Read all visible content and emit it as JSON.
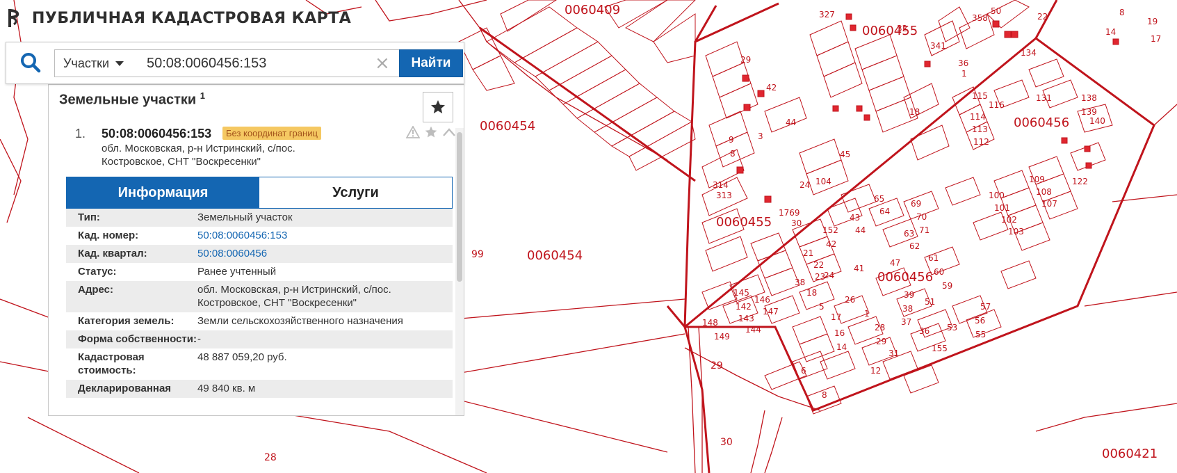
{
  "app": {
    "title": "ПУБЛИЧНАЯ КАДАСТРОВАЯ КАРТА"
  },
  "search": {
    "type_label": "Участки",
    "query": "50:08:0060456:153",
    "find_label": "Найти"
  },
  "results": {
    "header": "Земельные участки",
    "count": "1",
    "item": {
      "number": "1.",
      "title": "50:08:0060456:153",
      "badge": "Без координат границ",
      "address": "обл. Московская, р-н Истринский, с/пос. Костровское, СНТ \"Воскресенки\""
    },
    "tabs": {
      "info": "Информация",
      "services": "Услуги"
    },
    "rows": [
      {
        "key": "Тип:",
        "value": "Земельный участок",
        "link": false
      },
      {
        "key": "Кад. номер:",
        "value": "50:08:0060456:153",
        "link": true
      },
      {
        "key": "Кад. квартал:",
        "value": "50:08:0060456",
        "link": true
      },
      {
        "key": "Статус:",
        "value": "Ранее учтенный",
        "link": false
      },
      {
        "key": "Адрес:",
        "value": "обл. Московская, р-н Истринский, с/пос. Костровское, СНТ \"Воскресенки\"",
        "link": false
      },
      {
        "key": "Категория земель:",
        "value": "Земли сельскохозяйственного назначения",
        "link": false
      },
      {
        "key": "Форма собственности:",
        "value": "-",
        "link": false
      },
      {
        "key": "Кадастровая стоимость:",
        "value": "48 887 059,20 руб.",
        "link": false
      },
      {
        "key": "Декларированная",
        "value": "49 840 кв. м",
        "link": false
      }
    ]
  },
  "map": {
    "quarter_labels": [
      "0060409",
      "0060455",
      "0060454",
      "0060456",
      "0060454",
      "0060455",
      "0060456",
      "0060421"
    ],
    "parcel_labels": [
      "99",
      "29",
      "30",
      "28",
      "18",
      "45",
      "24",
      "104",
      "44",
      "3",
      "8",
      "9",
      "29",
      "42",
      "314",
      "313",
      "1769",
      "30",
      "152",
      "42",
      "43",
      "44",
      "65",
      "64",
      "69",
      "70",
      "71",
      "63",
      "62",
      "21",
      "22",
      "23",
      "24",
      "41",
      "47",
      "61",
      "60",
      "59",
      "38",
      "18",
      "5",
      "17",
      "26",
      "1",
      "28",
      "29",
      "31",
      "39",
      "38",
      "37",
      "36",
      "51",
      "53",
      "57",
      "56",
      "55",
      "155",
      "16",
      "14",
      "12",
      "6",
      "8",
      "145",
      "146",
      "147",
      "148",
      "149",
      "142",
      "143",
      "144",
      "100",
      "101",
      "102",
      "103",
      "109",
      "108",
      "107",
      "122",
      "114",
      "113",
      "112",
      "115",
      "116",
      "131",
      "138",
      "139",
      "140",
      "134",
      "327",
      "32",
      "341",
      "36",
      "1",
      "358",
      "50",
      "22",
      "14",
      "8",
      "19",
      "17"
    ],
    "colors": {
      "line": "#c0141c",
      "text": "#c0141c"
    }
  }
}
